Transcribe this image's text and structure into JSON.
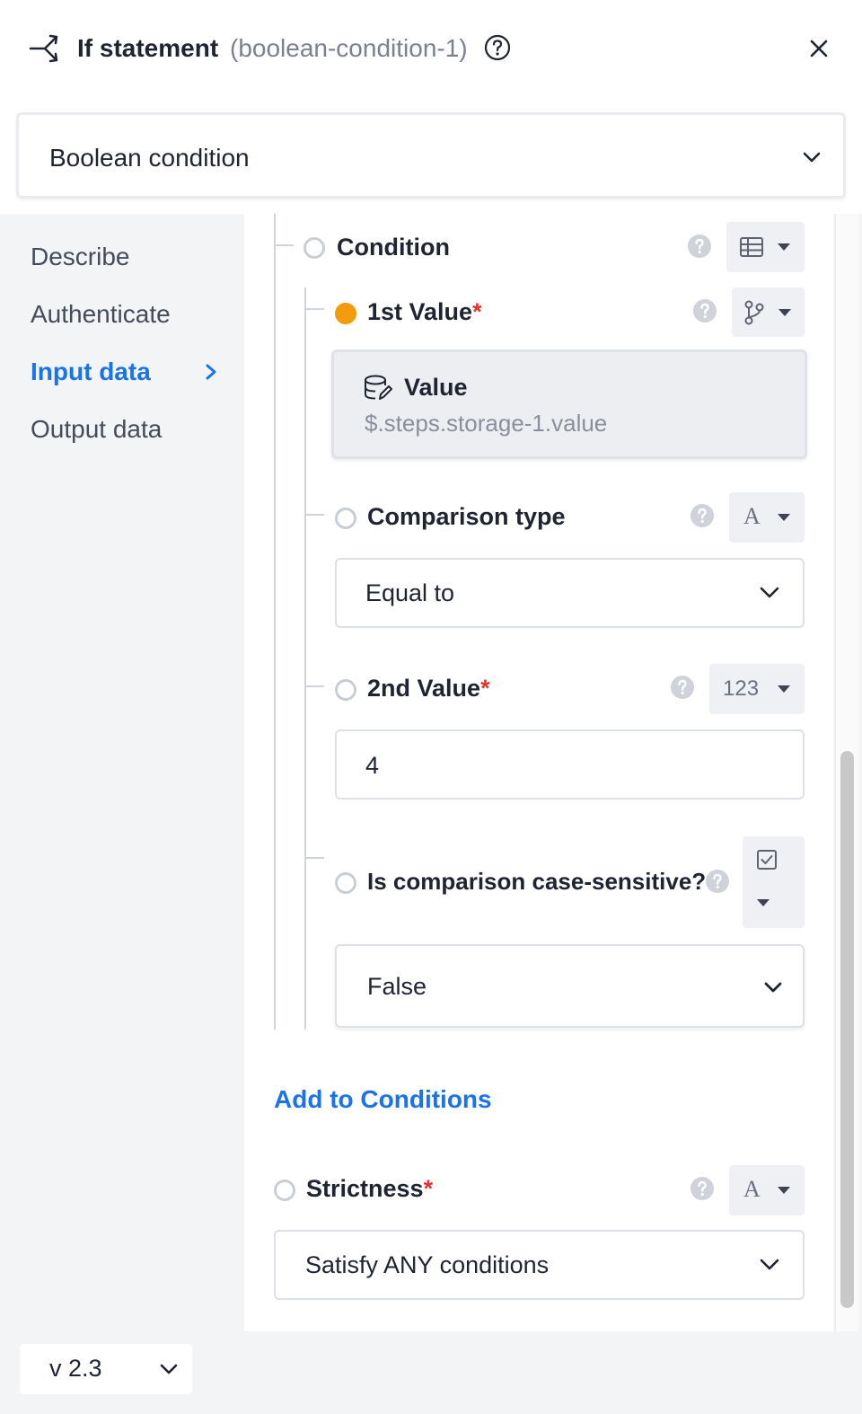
{
  "header": {
    "title": "If statement",
    "subtitle": "(boolean-condition-1)",
    "icons": {
      "step": "branch-icon",
      "help": "help-circle-icon",
      "close": "close-icon"
    }
  },
  "type_select": {
    "value": "Boolean condition",
    "icon": "chevron-down-icon"
  },
  "sidebar": {
    "items": [
      {
        "label": "Describe",
        "active": false
      },
      {
        "label": "Authenticate",
        "active": false
      },
      {
        "label": "Input data",
        "active": true
      },
      {
        "label": "Output data",
        "active": false
      }
    ],
    "active_indicator": "chevron-right-icon"
  },
  "condition": {
    "label": "Condition",
    "type_icon": "table-icon",
    "first_value": {
      "label": "1st Value",
      "required": "*",
      "type_icon": "branch-fork-icon",
      "card_title": "Value",
      "card_path": "$.steps.storage-1.value",
      "card_icon": "database-edit-icon"
    },
    "comparison": {
      "label": "Comparison type",
      "type_glyph": "A",
      "value": "Equal to"
    },
    "second_value": {
      "label": "2nd Value",
      "required": "*",
      "type_glyph": "123",
      "value": "4"
    },
    "case_sensitive": {
      "label": "Is comparison case-sensitive?",
      "type_icon": "checkbox-icon",
      "value": "False"
    }
  },
  "add_conditions": "Add to Conditions",
  "strictness": {
    "label": "Strictness",
    "required": "*",
    "type_glyph": "A",
    "value": "Satisfy ANY conditions"
  },
  "version": {
    "label": "v 2.3"
  },
  "colors": {
    "accent": "#1a73e8",
    "required": "#e0342c",
    "active_dot": "#f29b0c"
  }
}
